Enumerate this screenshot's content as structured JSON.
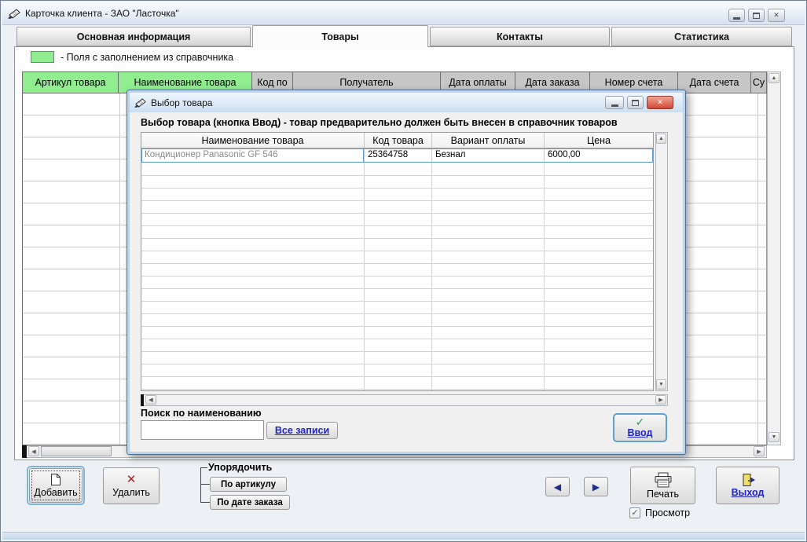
{
  "window": {
    "title": "Карточка клиента  -  ЗАО \"Ласточка\""
  },
  "tabs": [
    {
      "label": "Основная информация",
      "active": false
    },
    {
      "label": "Товары",
      "active": true
    },
    {
      "label": "Контакты",
      "active": false
    },
    {
      "label": "Статистика",
      "active": false
    }
  ],
  "legend": {
    "label": "- Поля с заполнением из справочника",
    "swatch_color": "#90EE90"
  },
  "main_table": {
    "columns": [
      "Артикул товара",
      "Наименование товара",
      "Код по",
      "Получатель",
      "Дата оплаты",
      "Дата заказа",
      "Номер счета",
      "Дата счета",
      "Су"
    ]
  },
  "dialog": {
    "title": "Выбор товара",
    "instruction": "Выбор товара (кнопка Ввод) - товар предварительно должен быть внесен в справочник товаров",
    "table": {
      "columns": [
        "Наименование товара",
        "Код товара",
        "Вариант оплаты",
        "Цена"
      ],
      "rows": [
        {
          "name": "Кондиционер Panasonic GF 546",
          "code": "25364758",
          "payment": "Безнал",
          "price": "6000,00"
        }
      ]
    },
    "search_label": "Поиск по наименованию",
    "search_value": "",
    "buttons": {
      "all_records": "Все записи",
      "enter": "Ввод"
    }
  },
  "footer": {
    "add": "Добавить",
    "delete": "Удалить",
    "order_group": "Упорядочить",
    "order_by_article": "По артикулу",
    "order_by_order_date": "По дате заказа",
    "print": "Печать",
    "preview": "Просмотр",
    "preview_checked": true,
    "exit": "Выход"
  },
  "colors": {
    "reference_green": "#90EE90",
    "link_blue": "#2222CC",
    "selection_blue": "#5A9BD5",
    "delete_red": "#A3262C",
    "check_green": "#2E9E3E",
    "nav_arrow_blue": "#1D2F86"
  },
  "icons": {
    "close": "✕",
    "scroll_up": "▲",
    "scroll_down": "▼",
    "scroll_left": "◀",
    "scroll_right": "▶",
    "nav_left": "◀",
    "nav_right": "▶",
    "delete_cross": "✕",
    "enter_check": "✓",
    "checkbox_check": "✓"
  }
}
